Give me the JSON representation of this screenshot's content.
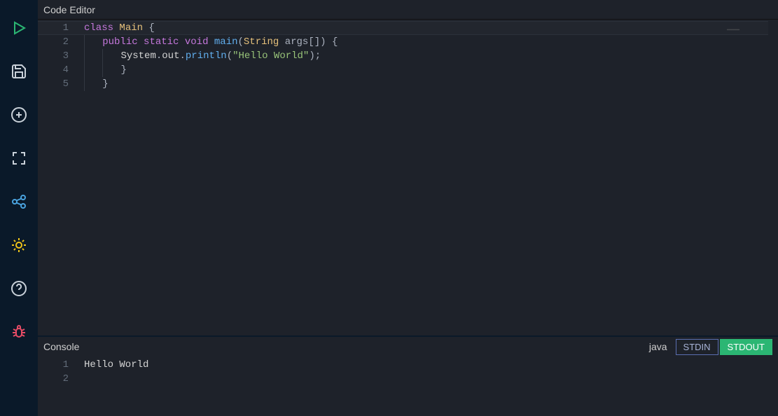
{
  "editor": {
    "title": "Code Editor",
    "language": "java",
    "lines": [
      {
        "num": 1,
        "indent": 0,
        "tokens": [
          [
            "kw",
            "class"
          ],
          [
            "pn",
            " "
          ],
          [
            "cls",
            "Main"
          ],
          [
            "pn",
            " {"
          ]
        ]
      },
      {
        "num": 2,
        "indent": 1,
        "tokens": [
          [
            "kw",
            "public"
          ],
          [
            "pn",
            " "
          ],
          [
            "kw",
            "static"
          ],
          [
            "pn",
            " "
          ],
          [
            "kw",
            "void"
          ],
          [
            "pn",
            " "
          ],
          [
            "fn",
            "main"
          ],
          [
            "pn",
            "("
          ],
          [
            "cls",
            "String"
          ],
          [
            "pn",
            " args[]) {"
          ]
        ]
      },
      {
        "num": 3,
        "indent": 2,
        "tokens": [
          [
            "id",
            "System"
          ],
          [
            "pn",
            "."
          ],
          [
            "id",
            "out"
          ],
          [
            "pn",
            "."
          ],
          [
            "fn",
            "println"
          ],
          [
            "pn",
            "("
          ],
          [
            "str",
            "\"Hello World\""
          ],
          [
            "pn",
            ");"
          ]
        ]
      },
      {
        "num": 4,
        "indent": 2,
        "tokens": [
          [
            "pn",
            "}"
          ]
        ]
      },
      {
        "num": 5,
        "indent": 1,
        "tokens": [
          [
            "pn",
            "}"
          ]
        ]
      }
    ]
  },
  "console": {
    "title": "Console",
    "tabs": {
      "stdin": "STDIN",
      "stdout": "STDOUT",
      "active": "stdout"
    },
    "output_lines": [
      {
        "num": 1,
        "text": "Hello World"
      },
      {
        "num": 2,
        "text": ""
      }
    ]
  },
  "sidebar": {
    "items": [
      {
        "name": "run",
        "color": "#2bb673"
      },
      {
        "name": "save",
        "color": "#c9d1d9"
      },
      {
        "name": "add",
        "color": "#c9d1d9"
      },
      {
        "name": "fullscreen",
        "color": "#c9d1d9"
      },
      {
        "name": "share",
        "color": "#4aa3df"
      },
      {
        "name": "theme",
        "color": "#f0c419"
      },
      {
        "name": "help",
        "color": "#c9d1d9"
      },
      {
        "name": "debug",
        "color": "#e74c66"
      }
    ]
  }
}
